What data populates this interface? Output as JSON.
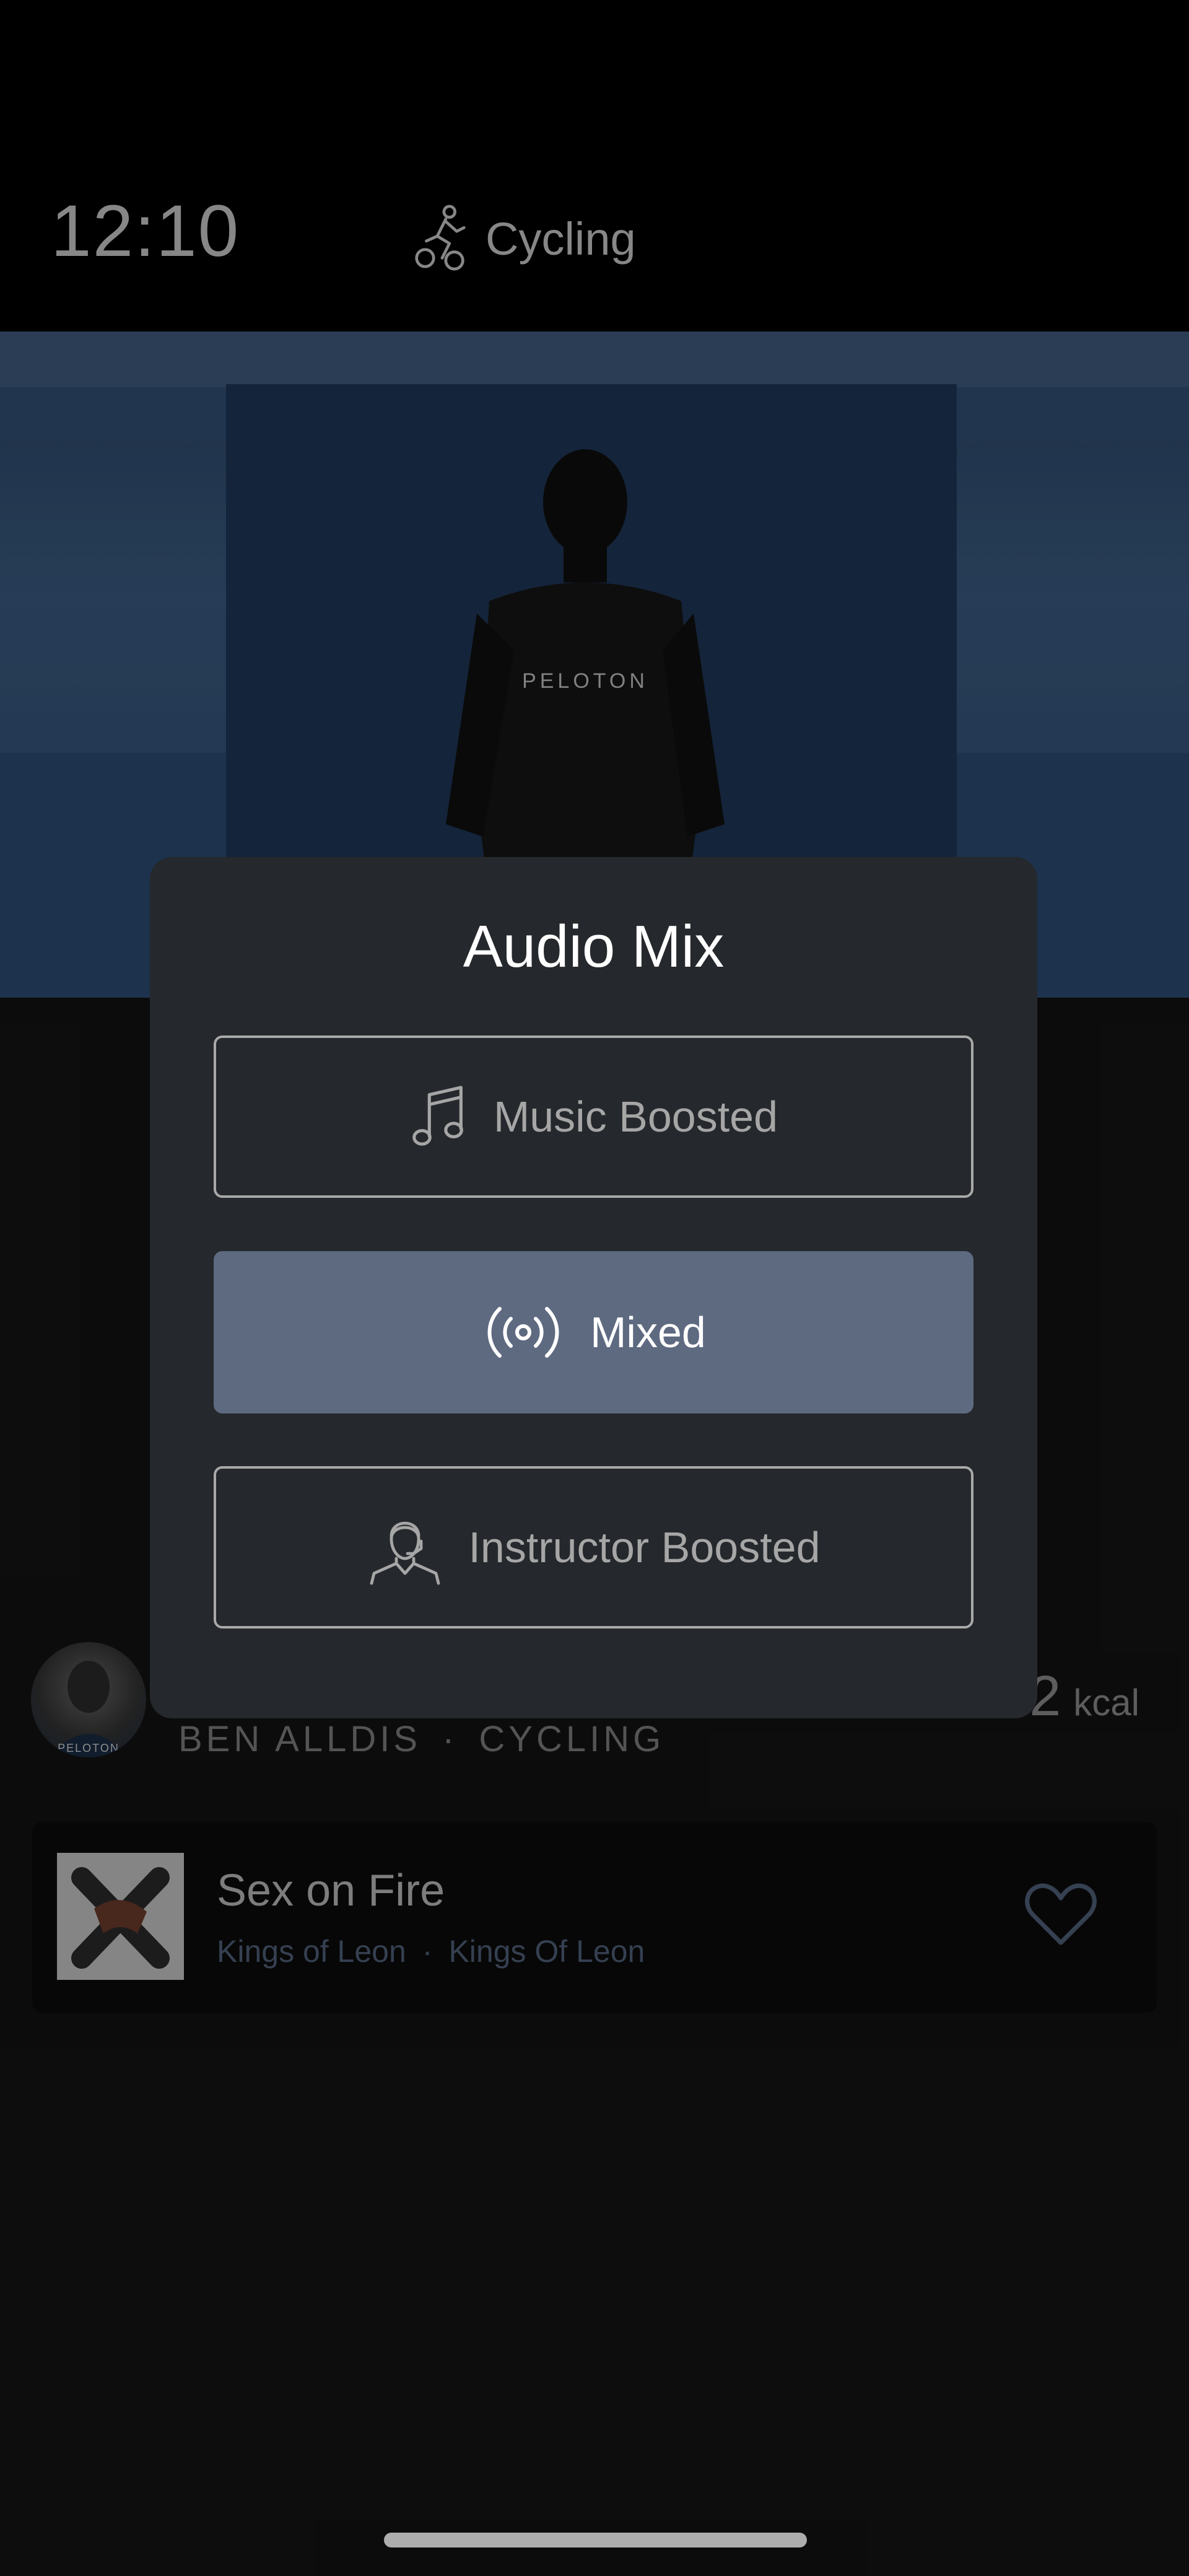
{
  "status": {
    "time": "12:10",
    "discipline_label": "Cycling",
    "discipline_icon": "cycling-icon"
  },
  "video": {
    "shirt_text": "PELOTON"
  },
  "class_info": {
    "kcal_value": "2",
    "kcal_unit": "kcal",
    "instructor": "BEN ALLDIS",
    "separator": "·",
    "class_type": "CYCLING",
    "avatar_label": "PELOTON"
  },
  "now_playing": {
    "title": "Sex on Fire",
    "artist": "Kings of Leon",
    "separator": "·",
    "album": "Kings Of Leon",
    "heart_icon": "heart-icon"
  },
  "audio_mix_modal": {
    "title": "Audio Mix",
    "options": [
      {
        "label": "Music Boosted",
        "icon": "music-note-icon",
        "selected": false
      },
      {
        "label": "Mixed",
        "icon": "broadcast-icon",
        "selected": true
      },
      {
        "label": "Instructor Boosted",
        "icon": "headset-person-icon",
        "selected": false
      }
    ]
  },
  "colors": {
    "modal_bg": "#25282c",
    "selected_option_bg": "#5e6a80",
    "option_border": "#a9a9a9",
    "background": "#131313"
  }
}
